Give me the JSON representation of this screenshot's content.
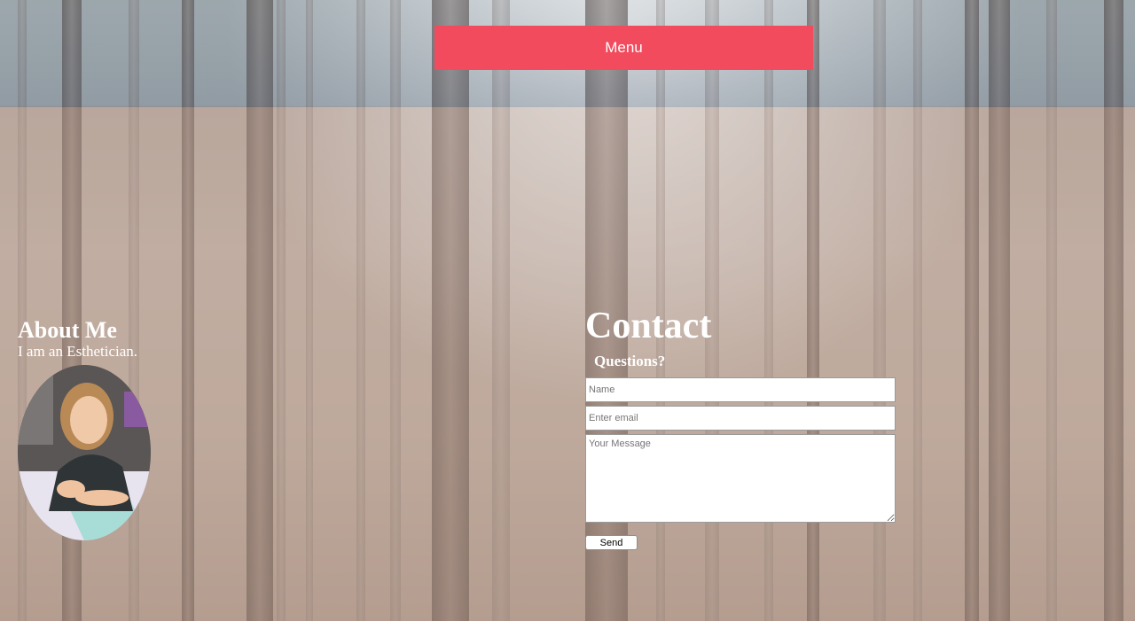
{
  "nav": {
    "menu_label": "Menu"
  },
  "about": {
    "heading": "About Me",
    "tagline": "I am an Esthetician.",
    "photo_icon": "profile-photo"
  },
  "contact": {
    "heading": "Contact",
    "subheading": "Questions?",
    "name_placeholder": "Name",
    "email_placeholder": "Enter email",
    "message_placeholder": "Your Message",
    "send_label": "Send"
  },
  "colors": {
    "menu_button": "#f24b5d",
    "text": "#ffffff"
  }
}
